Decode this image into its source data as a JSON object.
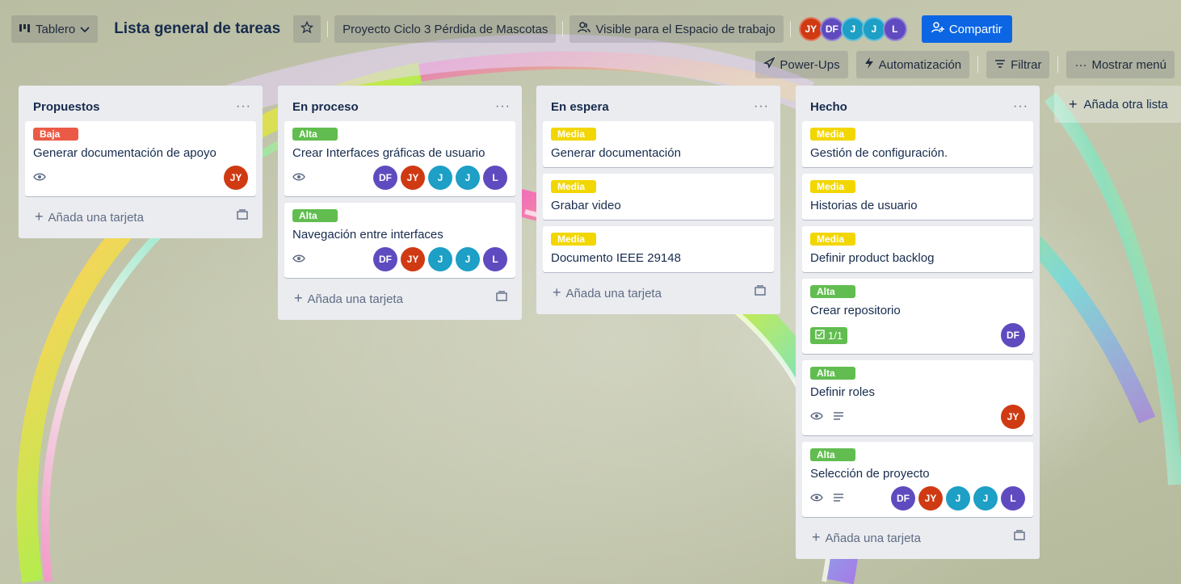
{
  "header": {
    "view_switcher": "Tablero",
    "board_title": "Lista general de tareas",
    "workspace": "Proyecto Ciclo 3 Pérdida de Mascotas",
    "visibility": "Visible para el Espacio de trabajo",
    "members": [
      "JY",
      "DF",
      "J",
      "J",
      "L"
    ],
    "share_label": "Compartir",
    "power_ups": "Power-Ups",
    "automation": "Automatización",
    "filter": "Filtrar",
    "menu": "Mostrar menú"
  },
  "lists": [
    {
      "title": "Propuestos",
      "add_card": "Añada una tarjeta",
      "cards": [
        {
          "label": "Baja",
          "label_color": "#eb5a46",
          "title": "Generar documentación de apoyo",
          "watch": true,
          "members": [
            "JY"
          ]
        }
      ]
    },
    {
      "title": "En proceso",
      "add_card": "Añada una tarjeta",
      "cards": [
        {
          "label": "Alta",
          "label_color": "#61bd4f",
          "title": "Crear Interfaces gráficas de usuario",
          "watch": true,
          "members": [
            "DF",
            "JY",
            "J",
            "J",
            "L"
          ]
        },
        {
          "label": "Alta",
          "label_color": "#61bd4f",
          "title": "Navegación entre interfaces",
          "watch": true,
          "members": [
            "DF",
            "JY",
            "J",
            "J",
            "L"
          ]
        }
      ]
    },
    {
      "title": "En espera",
      "add_card": "Añada una tarjeta",
      "cards": [
        {
          "label": "Media",
          "label_color": "#f2d600",
          "title": "Generar documentación"
        },
        {
          "label": "Media",
          "label_color": "#f2d600",
          "title": "Grabar video"
        },
        {
          "label": "Media",
          "label_color": "#f2d600",
          "title": "Documento IEEE 29148"
        }
      ]
    },
    {
      "title": "Hecho",
      "add_card": "Añada una tarjeta",
      "cards": [
        {
          "label": "Media",
          "label_color": "#f2d600",
          "title": "Gestión de configuración."
        },
        {
          "label": "Media",
          "label_color": "#f2d600",
          "title": "Historias de usuario"
        },
        {
          "label": "Media",
          "label_color": "#f2d600",
          "title": "Definir product backlog"
        },
        {
          "label": "Alta",
          "label_color": "#61bd4f",
          "title": "Crear repositorio",
          "checklist": "1/1",
          "members": [
            "DF"
          ]
        },
        {
          "label": "Alta",
          "label_color": "#61bd4f",
          "title": "Definir roles",
          "watch": true,
          "description": true,
          "members": [
            "JY"
          ]
        },
        {
          "label": "Alta",
          "label_color": "#61bd4f",
          "title": "Selección de proyecto",
          "watch": true,
          "description": true,
          "members": [
            "DF",
            "JY",
            "J",
            "J",
            "L"
          ]
        }
      ]
    }
  ],
  "add_list": "Añada otra lista",
  "colors": {
    "accent": "#0c66e4",
    "list_bg": "#ebecf0",
    "JY": "#cf3a13",
    "DF": "#5f4bbf",
    "J": "#1d9fc6",
    "L": "#5f4bbf"
  }
}
